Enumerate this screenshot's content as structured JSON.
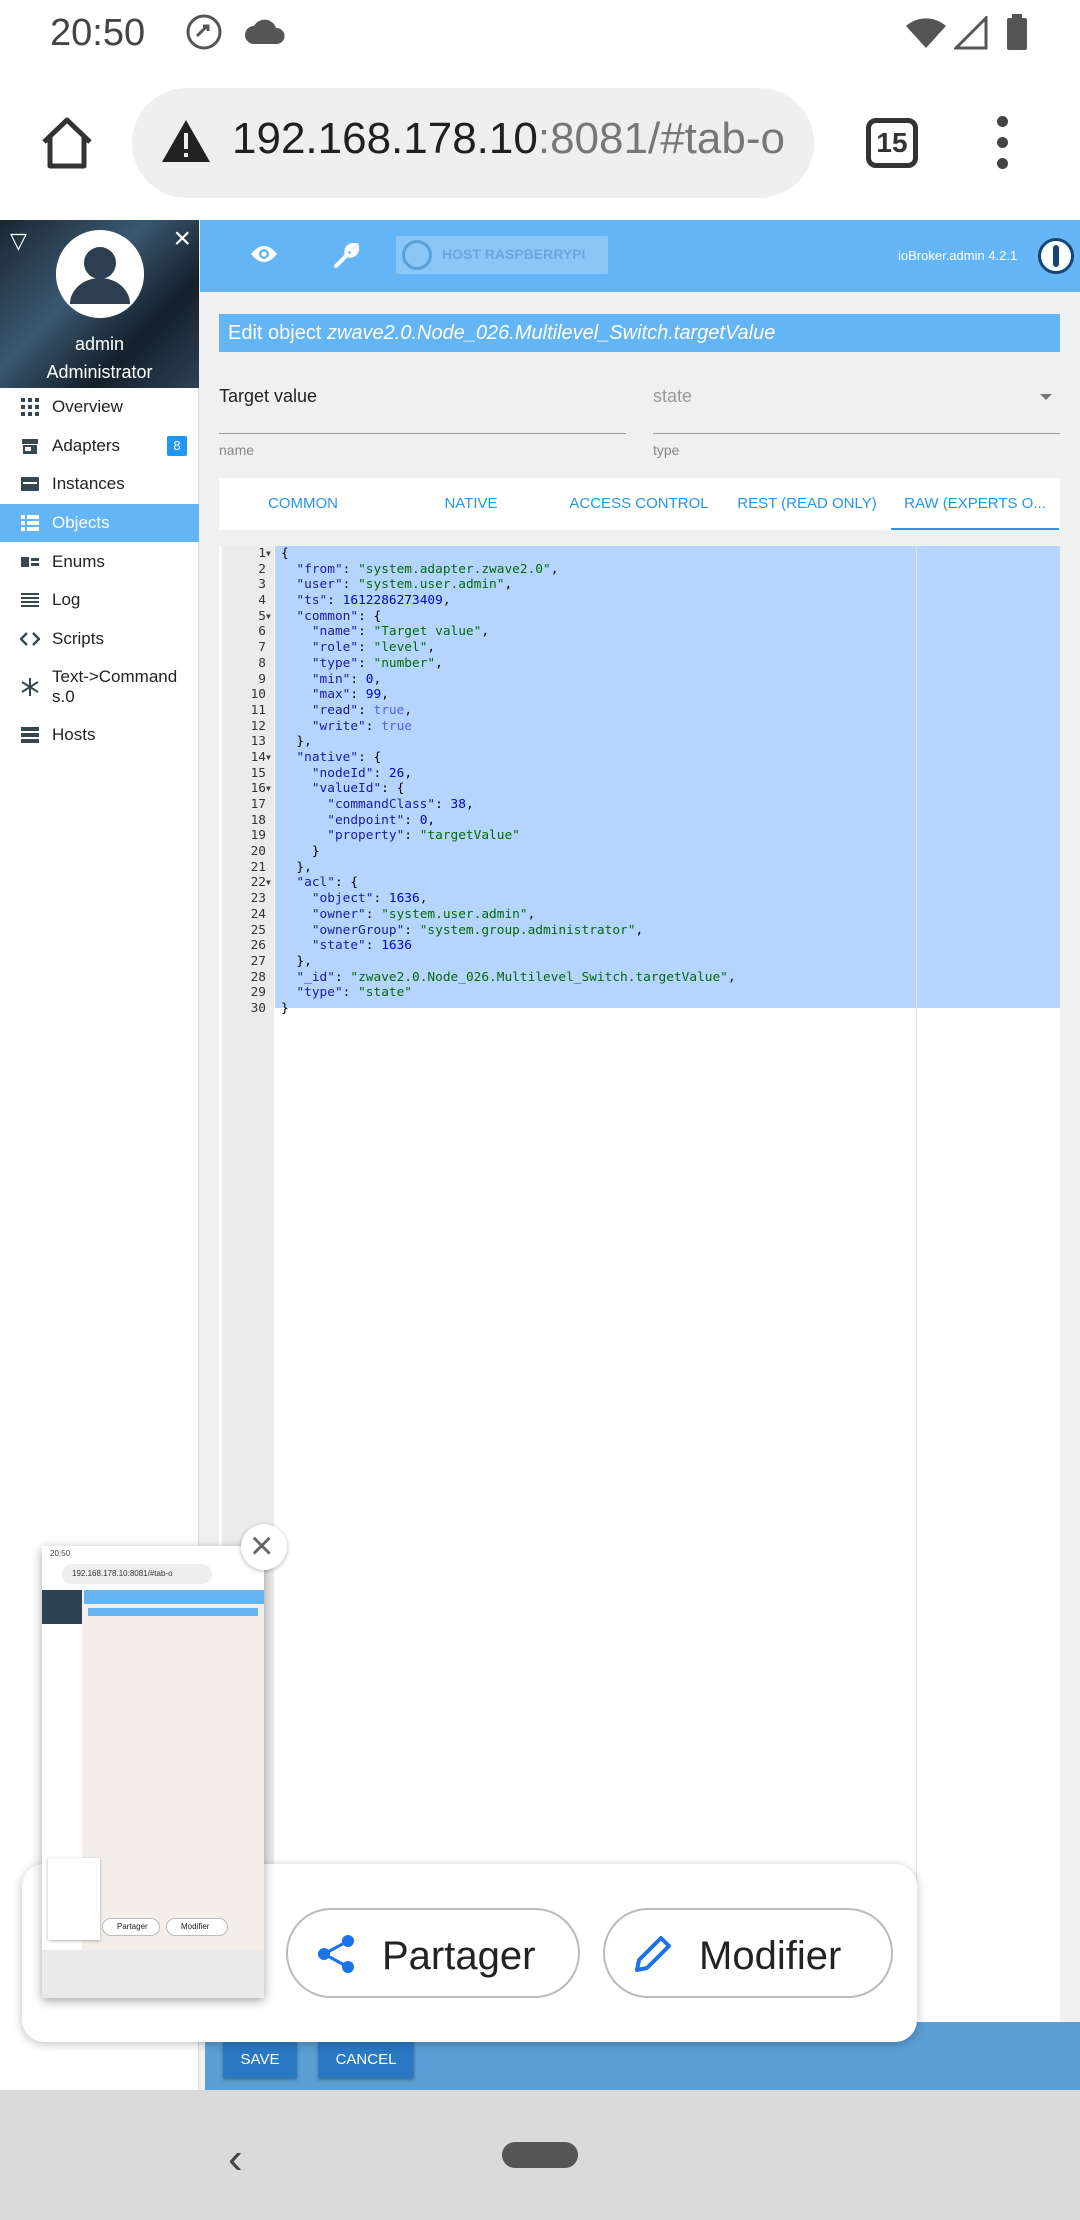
{
  "status_bar": {
    "time": "20:50"
  },
  "browser": {
    "url_host": "192.168.178.10",
    "url_rest": ":8081/#tab-o",
    "tab_count": "15"
  },
  "sidebar": {
    "user_name": "admin",
    "user_role": "Administrator",
    "items": [
      {
        "label": "Overview",
        "icon": "grid-icon"
      },
      {
        "label": "Adapters",
        "icon": "store-icon",
        "badge": "8"
      },
      {
        "label": "Instances",
        "icon": "card-icon"
      },
      {
        "label": "Objects",
        "icon": "list-icon",
        "active": true
      },
      {
        "label": "Enums",
        "icon": "enum-icon"
      },
      {
        "label": "Log",
        "icon": "lines-icon"
      },
      {
        "label": "Scripts",
        "icon": "code-icon"
      },
      {
        "label": "Text->Commands.0",
        "icon": "snowflake-icon"
      },
      {
        "label": "Hosts",
        "icon": "hosts-icon"
      }
    ]
  },
  "topbar": {
    "host_label": "HOST RASPBERRYPI",
    "version": "ioBroker.admin 4.2.1"
  },
  "dialog": {
    "title_prefix": "Edit object ",
    "title_id": "zwave2.0.Node_026.Multilevel_Switch.targetValue",
    "name_value": "Target value",
    "name_label": "name",
    "type_value": "state",
    "type_label": "type",
    "tabs": [
      "COMMON",
      "NATIVE",
      "ACCESS CONTROL",
      "REST (READ ONLY)",
      "RAW (EXPERTS O..."
    ],
    "active_tab": 4,
    "save_label": "SAVE",
    "cancel_label": "CANCEL"
  },
  "code_lines": [
    "{",
    "  \"from\": \"system.adapter.zwave2.0\",",
    "  \"user\": \"system.user.admin\",",
    "  \"ts\": 1612286273409,",
    "  \"common\": {",
    "    \"name\": \"Target value\",",
    "    \"role\": \"level\",",
    "    \"type\": \"number\",",
    "    \"min\": 0,",
    "    \"max\": 99,",
    "    \"read\": true,",
    "    \"write\": true",
    "  },",
    "  \"native\": {",
    "    \"nodeId\": 26,",
    "    \"valueId\": {",
    "      \"commandClass\": 38,",
    "      \"endpoint\": 0,",
    "      \"property\": \"targetValue\"",
    "    }",
    "  },",
    "  \"acl\": {",
    "    \"object\": 1636,",
    "    \"owner\": \"system.user.admin\",",
    "    \"ownerGroup\": \"system.group.administrator\",",
    "    \"state\": 1636",
    "  },",
    "  \"_id\": \"zwave2.0.Node_026.Multilevel_Switch.targetValue\",",
    "  \"type\": \"state\"",
    "}"
  ],
  "fold_lines": [
    1,
    5,
    14,
    16,
    22
  ],
  "screenshot_overlay": {
    "share_label": "Partager",
    "edit_label": "Modifier",
    "thumb_time": "20:50",
    "thumb_url": "192.168.178.10:8081/#tab-o"
  },
  "colors": {
    "accent": "#64b5f6",
    "primary_button": "#2b78c4",
    "selection": "#b5d5ff"
  }
}
